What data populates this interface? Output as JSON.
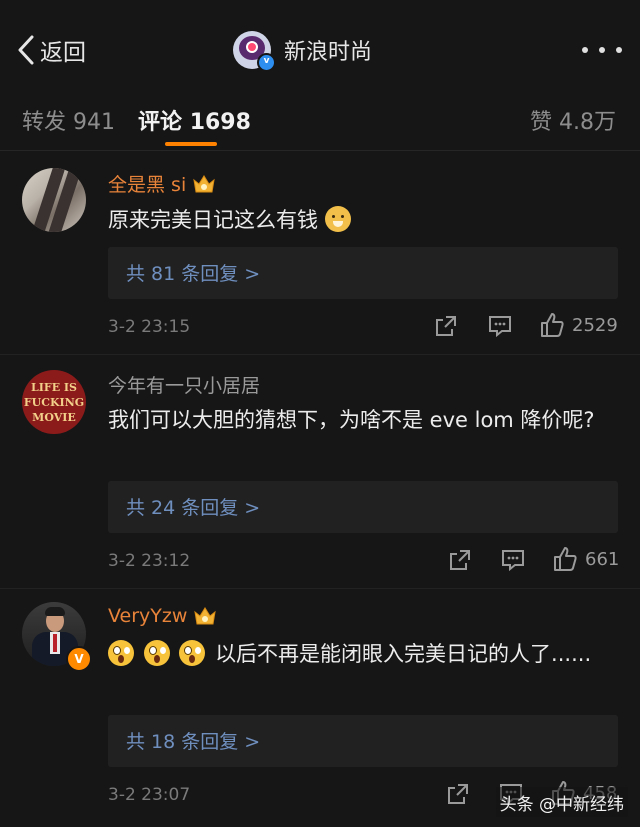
{
  "header": {
    "back_label": "返回",
    "title": "新浪时尚"
  },
  "tabs": [
    {
      "label": "转发",
      "count": "941"
    },
    {
      "label": "评论",
      "count": "1698"
    },
    {
      "label": "赞",
      "count": "4.8万"
    }
  ],
  "comments": [
    {
      "username": "全是黑 si",
      "text": "原来完美日记这么有钱",
      "emojis": [
        "dog-face-emoji"
      ],
      "replies": "共 81 条回复 >",
      "time": "3-2 23:15",
      "likes": "2529"
    },
    {
      "username": "今年有一只小居居",
      "avatar_text": [
        "LIFE IS",
        "FUCKING",
        "MOVIE"
      ],
      "text": "我们可以大胆的猜想下，为啥不是 eve lom 降价呢?",
      "replies": "共 24 条回复 >",
      "time": "3-2 23:12",
      "likes": "661"
    },
    {
      "username": "VeryYzw",
      "badge": "V",
      "emojis": [
        "astonished-emoji",
        "astonished-emoji",
        "astonished-emoji"
      ],
      "text": "以后不再是能闭眼入完美日记的人了......",
      "replies": "共 18 条回复 >",
      "time": "3-2 23:07",
      "likes": "458"
    }
  ],
  "watermark": "头条 @中新经纬",
  "colors": {
    "background": "#161616",
    "accent": "#ff8200",
    "username_orange": "#e8833a",
    "reply_link": "#6f8fbf",
    "verified_blue": "#2d8ef0"
  }
}
